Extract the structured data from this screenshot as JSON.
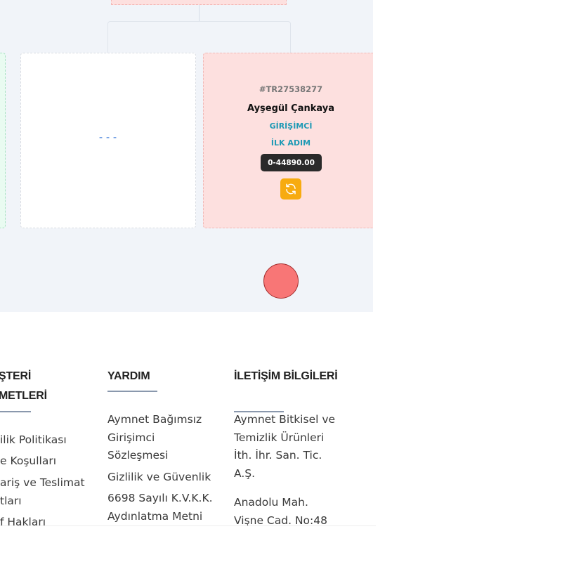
{
  "tree": {
    "empty_card": {
      "placeholder": "---"
    },
    "member_card": {
      "id": "#TR27538277",
      "name": "Ayşegül Çankaya",
      "role": "GİRİŞİMCİ",
      "level": "İLK ADIM",
      "balance": "0-44890.00",
      "action_icon": "refresh-icon"
    },
    "colors": {
      "background": "#f1f4f9",
      "member_card": "#fde0df",
      "partial_card_left": "#e9fbf1",
      "accent_teal": "#1f9ab5",
      "action_orange": "#f7ab10",
      "indicator_red": "#f87676"
    }
  },
  "footer": {
    "customer_col": {
      "heading_line1": "ŞTERİ",
      "heading_line2": "METLERİ",
      "links": [
        "ilik Politikası",
        "e Koşulları",
        "ariş ve Teslimat",
        "tları",
        "f Hakları"
      ]
    },
    "help_col": {
      "heading": "YARDIM",
      "links": [
        "Aymnet Bağımsız",
        "Girişimci",
        "Sözleşmesi",
        "Gizlilik ve Güvenlik",
        "6698 Sayılı K.V.K.K.",
        "Aydınlatma Metni"
      ]
    },
    "contact_col": {
      "heading": "İLETİŞİM BİLGİLERİ",
      "lines": [
        "Aymnet Bitkisel ve",
        "Temizlik Ürünleri",
        "İth. İhr. San. Tic.",
        "A.Ş.",
        "Anadolu Mah.",
        "Vişne Cad. No:48"
      ]
    }
  }
}
